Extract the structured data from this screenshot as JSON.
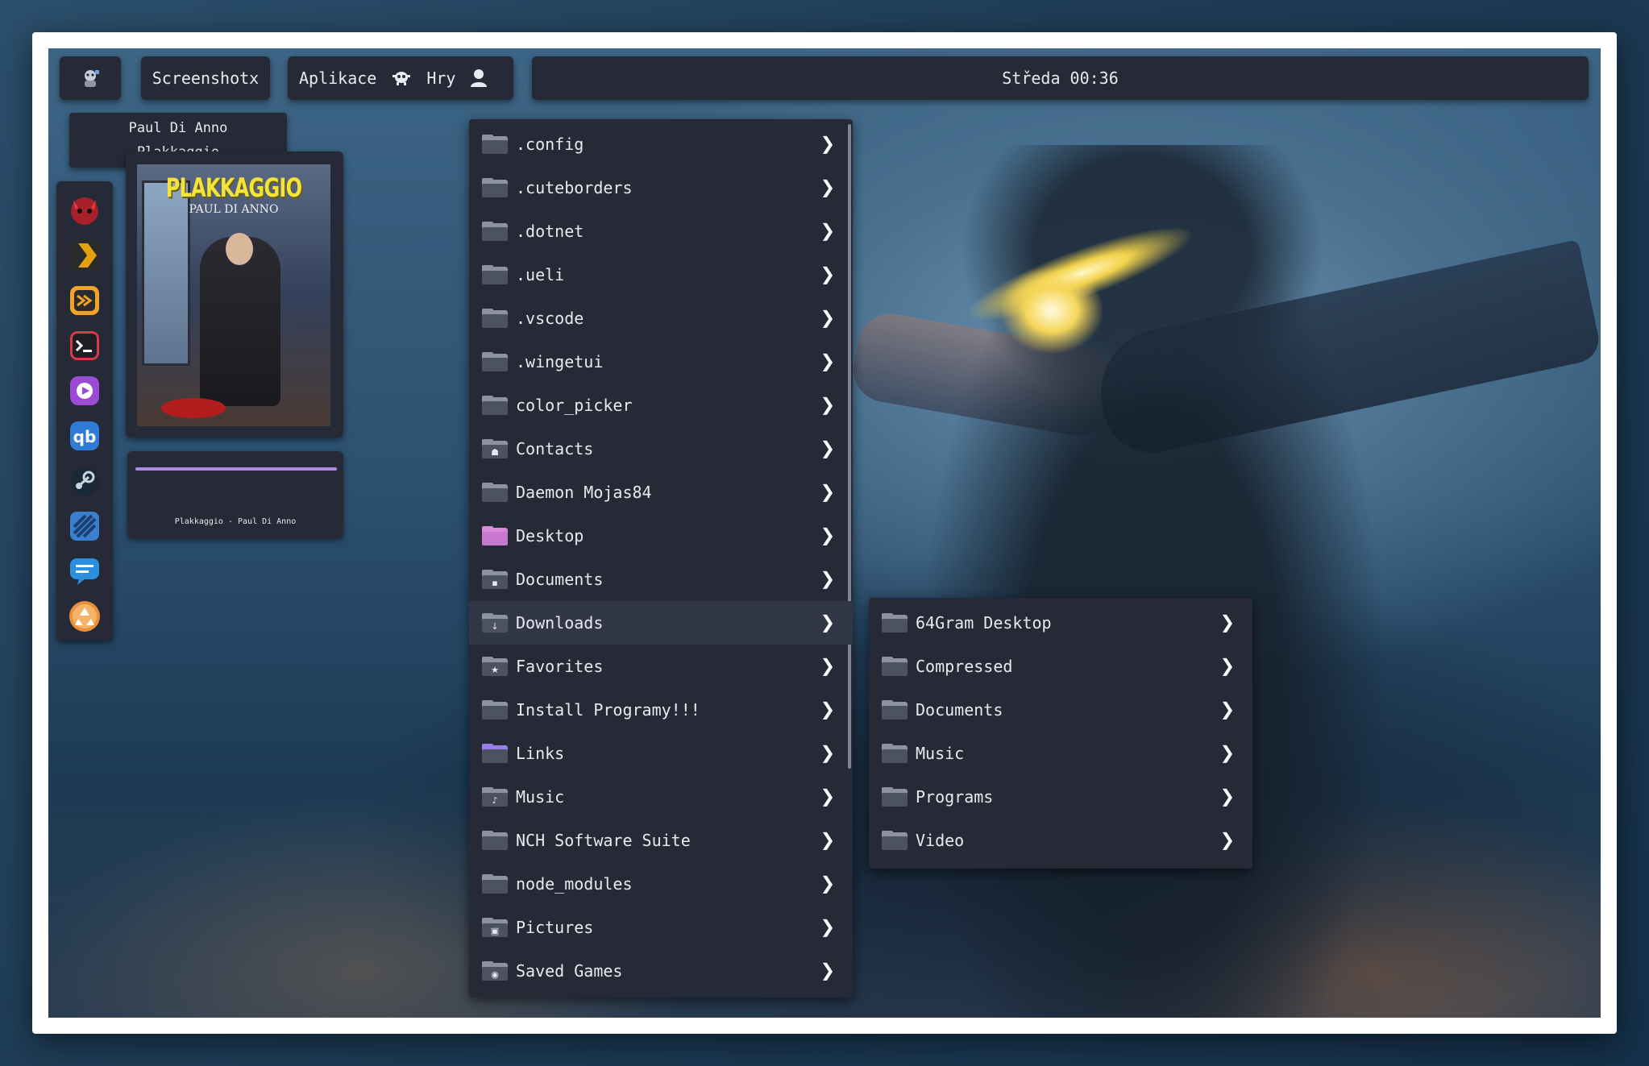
{
  "topbar": {
    "app_logo_icon": "mascot-icon",
    "title": "Screenshotx",
    "apps_label": "Aplikace",
    "games_label": "Hry",
    "clock": "Středa 00:36"
  },
  "tooltip": {
    "artist": "Paul Di Anno",
    "album": "Plakkaggio"
  },
  "dock": {
    "items": [
      {
        "icon": "devil-icon",
        "color": "#c0282d"
      },
      {
        "icon": "plex-icon",
        "color": "#e5a00d"
      },
      {
        "icon": "arrow-app-icon",
        "color": "#f2a32a"
      },
      {
        "icon": "terminal-icon",
        "color": "#d63b4a"
      },
      {
        "icon": "media-player-icon",
        "color": "#9b4bd6"
      },
      {
        "icon": "qbittorrent-icon",
        "color": "#2f7bd8"
      },
      {
        "icon": "steam-icon",
        "color": "#1b2a3d"
      },
      {
        "icon": "zebra-app-icon",
        "color": "#3a7fd0"
      },
      {
        "icon": "chat-icon",
        "color": "#2b8fe0"
      },
      {
        "icon": "recycle-icon",
        "color": "#e8913a"
      }
    ]
  },
  "cover": {
    "title": "PLAKKAGGIO",
    "artist": "PAUL DI ANNO"
  },
  "player": {
    "progress": 1.0,
    "now_playing": "Plakkaggio - Paul Di Anno"
  },
  "menu": {
    "items": [
      {
        "label": ".config",
        "glyph": ""
      },
      {
        "label": ".cuteborders",
        "glyph": ""
      },
      {
        "label": ".dotnet",
        "glyph": ""
      },
      {
        "label": ".ueli",
        "glyph": ""
      },
      {
        "label": ".vscode",
        "glyph": ""
      },
      {
        "label": ".wingetui",
        "glyph": ""
      },
      {
        "label": "color_picker",
        "glyph": ""
      },
      {
        "label": "Contacts",
        "glyph": "☗"
      },
      {
        "label": "Daemon Mojas84",
        "glyph": ""
      },
      {
        "label": "Desktop",
        "glyph": ""
      },
      {
        "label": "Documents",
        "glyph": "▪"
      },
      {
        "label": "Downloads",
        "glyph": "↓"
      },
      {
        "label": "Favorites",
        "glyph": "★"
      },
      {
        "label": "Install Programy!!!",
        "glyph": ""
      },
      {
        "label": "Links",
        "glyph": ""
      },
      {
        "label": "Music",
        "glyph": "♪"
      },
      {
        "label": "NCH Software Suite",
        "glyph": ""
      },
      {
        "label": "node_modules",
        "glyph": ""
      },
      {
        "label": "Pictures",
        "glyph": "▣"
      },
      {
        "label": "Saved Games",
        "glyph": "◉"
      }
    ]
  },
  "submenu": {
    "items": [
      {
        "label": "64Gram Desktop"
      },
      {
        "label": "Compressed"
      },
      {
        "label": "Documents"
      },
      {
        "label": "Music"
      },
      {
        "label": "Programs"
      },
      {
        "label": "Video"
      }
    ]
  }
}
